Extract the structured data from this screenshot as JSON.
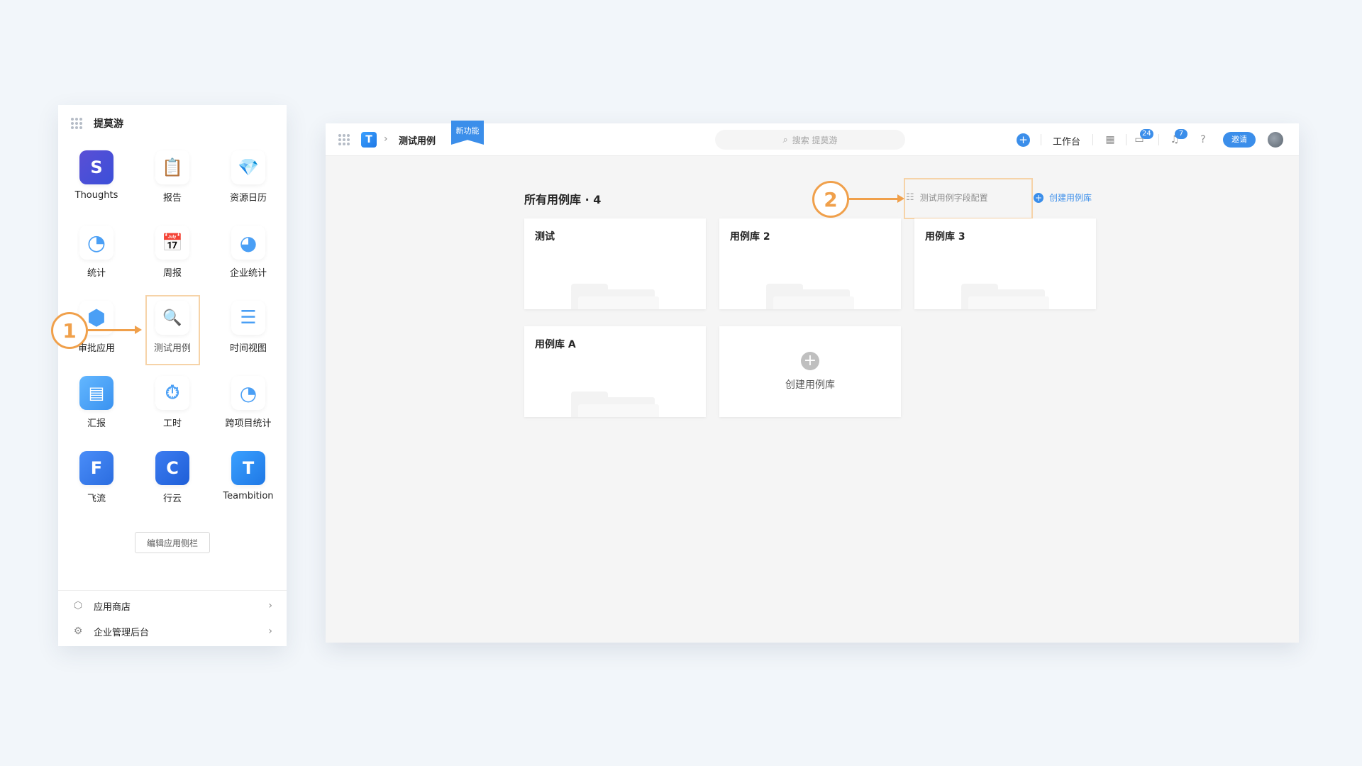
{
  "sidebar": {
    "title": "提莫游",
    "apps": [
      {
        "label": "Thoughts",
        "icon": "thoughts-icon",
        "glyph": "S"
      },
      {
        "label": "报告",
        "icon": "report-icon",
        "glyph": "📋"
      },
      {
        "label": "资源日历",
        "icon": "diamond-icon",
        "glyph": "💎"
      },
      {
        "label": "统计",
        "icon": "pie-chart-icon",
        "glyph": "◔"
      },
      {
        "label": "周报",
        "icon": "weekly-report-icon",
        "glyph": "📅"
      },
      {
        "label": "企业统计",
        "icon": "enterprise-stats-icon",
        "glyph": "◕"
      },
      {
        "label": "审批应用",
        "icon": "cube-icon",
        "glyph": "⬢"
      },
      {
        "label": "测试用例",
        "icon": "test-case-icon",
        "glyph": "🔍"
      },
      {
        "label": "时间视图",
        "icon": "timeline-icon",
        "glyph": "☰"
      },
      {
        "label": "汇报",
        "icon": "summary-report-icon",
        "glyph": "▤"
      },
      {
        "label": "工时",
        "icon": "stopwatch-icon",
        "glyph": "⏱"
      },
      {
        "label": "跨项目统计",
        "icon": "cross-project-stats-icon",
        "glyph": "◔"
      },
      {
        "label": "飞流",
        "icon": "feiliu-icon",
        "glyph": "F"
      },
      {
        "label": "行云",
        "icon": "xingyun-icon",
        "glyph": "C"
      },
      {
        "label": "Teambition",
        "icon": "teambition-icon",
        "glyph": "T"
      }
    ],
    "edit_button": "编辑应用侧栏",
    "links": [
      {
        "label": "应用商店",
        "icon": "box-icon"
      },
      {
        "label": "企业管理后台",
        "icon": "gear-icon"
      }
    ]
  },
  "annotations": {
    "step1": "1",
    "step2": "2"
  },
  "topbar": {
    "breadcrumb_title": "测试用例",
    "new_badge": "新功能",
    "search_placeholder": "搜索 提莫游",
    "workbench": "工作台",
    "messages_count": "24",
    "notifications_count": "7",
    "invite": "邀请"
  },
  "content": {
    "title": "所有用例库 · 4",
    "field_config": "测试用例字段配置",
    "create_link": "创建用例库",
    "libraries": [
      {
        "name": "测试"
      },
      {
        "name": "用例库 2"
      },
      {
        "name": "用例库 3"
      },
      {
        "name": "用例库 A"
      }
    ],
    "create_card_label": "创建用例库"
  },
  "colors": {
    "accent": "#3b8eea",
    "annotation": "#f0a04b",
    "highlight_border": "#f6d3a8"
  }
}
